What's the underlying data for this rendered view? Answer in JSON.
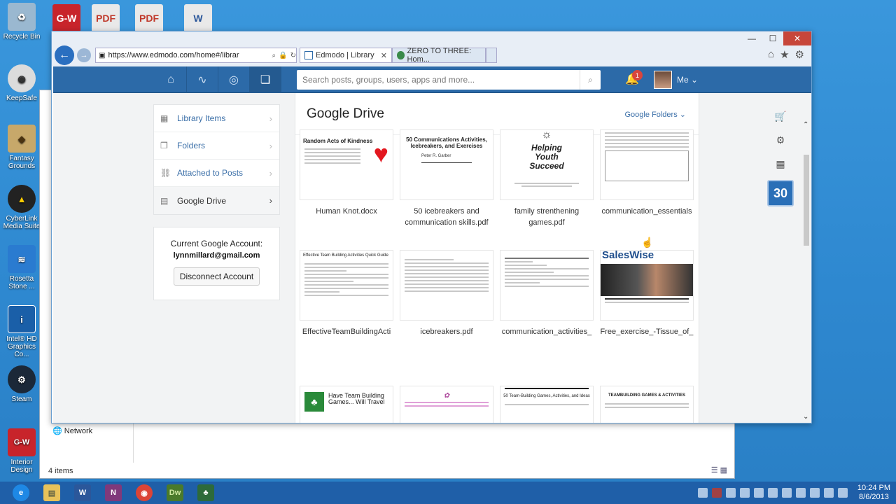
{
  "desktop": {
    "icons": [
      {
        "label": "Recycle Bin"
      },
      {
        "label": "KeepSafe"
      },
      {
        "label": "Fantasy Grounds"
      },
      {
        "label": "CyberLink Media Suite"
      },
      {
        "label": "Rosetta Stone ..."
      },
      {
        "label": "Intel® HD Graphics Co..."
      },
      {
        "label": "Steam"
      },
      {
        "label": "Interior Design"
      }
    ],
    "top_icons": [
      "G-W",
      "PDF",
      "PDF",
      "W"
    ]
  },
  "explorer": {
    "network_label": "Network",
    "items_count": "4 items"
  },
  "browser": {
    "address": "https://www.edmodo.com/home#/librar",
    "tabs": [
      {
        "label": "Edmodo | Library"
      },
      {
        "label": "ZERO TO THREE: Hom..."
      }
    ]
  },
  "edmodo": {
    "search_placeholder": "Search posts, groups, users, apps and more...",
    "notification_count": "1",
    "me_label": "Me",
    "side_menu": [
      {
        "label": "Library Items",
        "icon": "library-items-icon"
      },
      {
        "label": "Folders",
        "icon": "folders-icon"
      },
      {
        "label": "Attached to Posts",
        "icon": "link-icon"
      },
      {
        "label": "Google Drive",
        "icon": "google-drive-icon"
      }
    ],
    "account": {
      "label": "Current Google Account:",
      "email": "lynnmillard@gmail.com",
      "disconnect": "Disconnect Account"
    },
    "page_title": "Google Drive",
    "folders_dropdown": "Google Folders",
    "calendar_day": "30",
    "files": [
      {
        "name": "Human Knot.docx",
        "thumb_heading": "Random Acts of Kindness"
      },
      {
        "name": "50 icebreakers and communication skills.pdf",
        "thumb_heading": "50 Communications Activities, Icebreakers, and Exercises"
      },
      {
        "name": "family strenthening games.pdf",
        "thumb_heading": "Helping Youth Succeed"
      },
      {
        "name": "communication_essentials",
        "thumb_heading": ""
      },
      {
        "name": "EffectiveTeamBuildingActi",
        "thumb_heading": "Effective Team Building Activities Quick Guide"
      },
      {
        "name": "icebreakers.pdf",
        "thumb_heading": ""
      },
      {
        "name": "communication_activities_",
        "thumb_heading": ""
      },
      {
        "name": "Free_exercise_-Tissue_of_",
        "thumb_heading": "SalesWise"
      },
      {
        "name": "",
        "thumb_heading": "Have Team Building Games... Will Travel"
      },
      {
        "name": "",
        "thumb_heading": ""
      },
      {
        "name": "",
        "thumb_heading": "50 Team-Building Games, Activities, and Ideas"
      },
      {
        "name": "",
        "thumb_heading": "TEAMBUILDING GAMES & ACTIVITIES"
      }
    ]
  },
  "taskbar": {
    "time": "10:24 PM",
    "date": "8/6/2013"
  },
  "colors": {
    "edmodo_header": "#2c6aa8",
    "link": "#3b6fa8",
    "desktop": "#2e88d0",
    "badge": "#d9453c"
  }
}
